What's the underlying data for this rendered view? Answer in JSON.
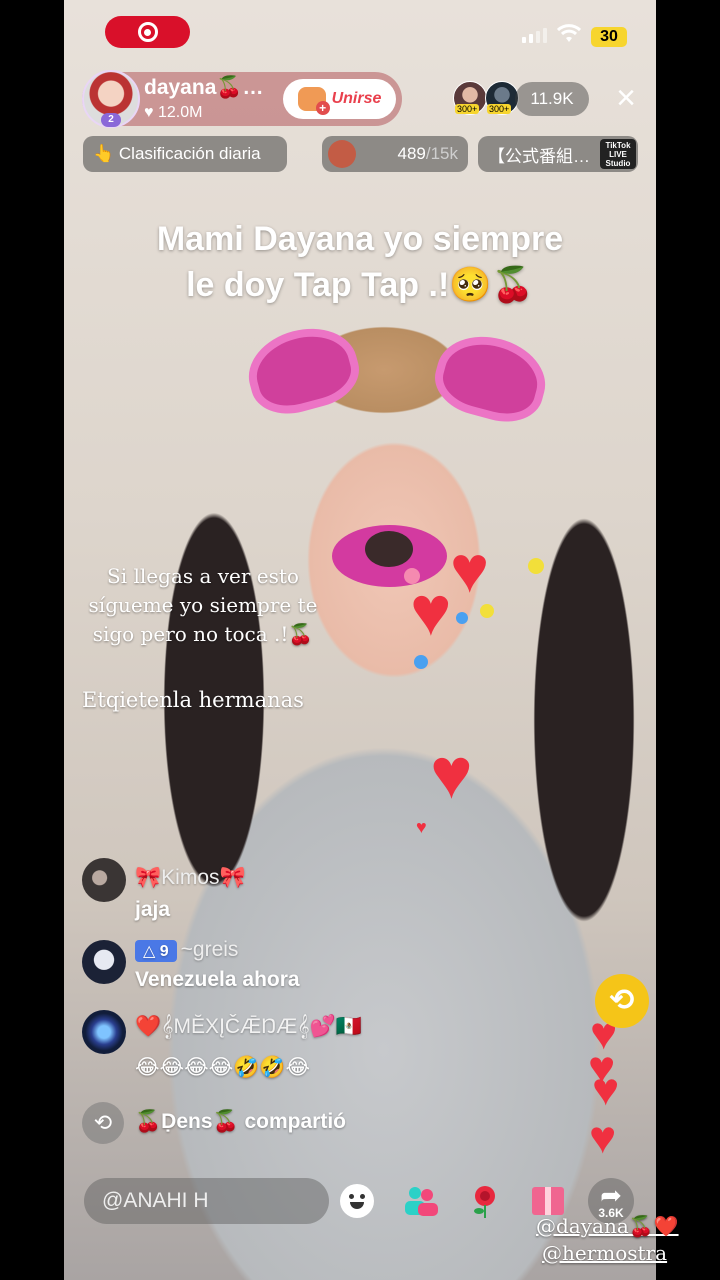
{
  "status_bar": {
    "battery": "30"
  },
  "host": {
    "name": "dayana🍒…",
    "likes": "♥ 12.0M",
    "badge": "2",
    "join_label": "Unirse"
  },
  "viewers": {
    "top_tags": [
      "300+",
      "300+"
    ],
    "count": "11.9K"
  },
  "pills": {
    "ranking": "👆 Clasificación diaria",
    "goal_current": "489",
    "goal_total": "/15k",
    "banner": "【公式番組…",
    "studio_logo": "TikTok LIVE Studio"
  },
  "caption": {
    "line1": "Mami Dayana yo siempre",
    "line2": "le doy Tap Tap .!🥺🍒"
  },
  "overlay_note": {
    "line1": "Si llegas a ver esto",
    "line2": "sígueme yo siempre te",
    "line3": "sigo pero no toca .!🍒",
    "tag_line": "Etqietenla hermanas"
  },
  "chat": [
    {
      "user": "🎀Kimos🎀",
      "message": "jaja"
    },
    {
      "level": "△ 9",
      "user": "~greis",
      "message": "Venezuela ahora"
    },
    {
      "user": "❤️𝄞MĔXĮČǢŊÆ𝄞💕🇲🇽",
      "message": "😂😂😂😂🤣🤣😂"
    }
  ],
  "share_event": {
    "text": "🍒Ḍens🍒 compartió"
  },
  "bottom_bar": {
    "comment_placeholder": "@ANAHI H",
    "share_count": "3.6K"
  },
  "handles": [
    "@dayana🍒❤️",
    "@hermostra"
  ],
  "colors": {
    "live_red": "#d9102a",
    "join_text": "#e9404d",
    "heart": "#f03040",
    "repost_fab": "#f5c518"
  },
  "icons": [
    "live-record-icon",
    "signal-icon",
    "wifi-icon",
    "close-icon",
    "join-heart-icon",
    "repost-icon",
    "emoji-icon",
    "guests-icon",
    "rose-icon",
    "gift-icon",
    "share-icon"
  ]
}
